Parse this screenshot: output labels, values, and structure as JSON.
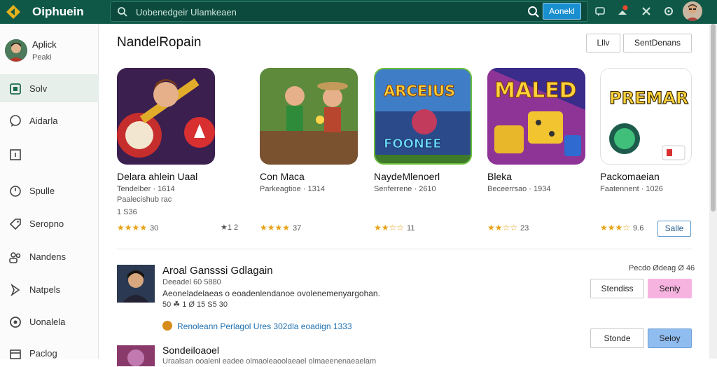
{
  "topbar": {
    "brand": "Oiphuein",
    "search_placeholder": "Uobenedgeir Ulamkeaen",
    "search_button": "Aonekl"
  },
  "sidebar": {
    "user_name": "Aplick",
    "user_sub": "Peaki",
    "items": [
      {
        "label": "Solv",
        "icon": "store-icon",
        "active": true
      },
      {
        "label": "Aidarla",
        "icon": "chat-icon"
      },
      {
        "label": "",
        "icon": "window-icon"
      },
      {
        "label": "Spulle",
        "icon": "clock-icon"
      },
      {
        "label": "Seropno",
        "icon": "tag-icon"
      },
      {
        "label": "Nandens",
        "icon": "people-icon"
      },
      {
        "label": "Natpels",
        "icon": "send-icon"
      },
      {
        "label": "Uonalela",
        "icon": "disc-icon"
      },
      {
        "label": "Paclog",
        "icon": "box-icon"
      }
    ]
  },
  "main": {
    "title": "NandelRopain",
    "header_buttons": [
      "Lllv",
      "SentDenans"
    ],
    "apps": [
      {
        "name": "Delara ahlein Uaal",
        "dev": "Tendelber · 1614",
        "meta": "Paalecishub rac",
        "meta2": "1 S36",
        "stars": "★★★★",
        "count": "30",
        "rating_extra": "★1 2"
      },
      {
        "name": "Con Maca",
        "dev": "Parkeagtioe · 1314",
        "meta": "",
        "meta2": "",
        "stars": "★★★★",
        "count": "37",
        "rating_extra": ""
      },
      {
        "name": "NaydeMlenoerl",
        "dev": "Senferrene · 2610",
        "meta": "",
        "meta2": "",
        "stars": "★★☆☆",
        "count": "11",
        "rating_extra": ""
      },
      {
        "name": "Bleka",
        "dev": "Beceerrsao · 1934",
        "meta": "",
        "meta2": "",
        "stars": "★★☆☆",
        "count": "23",
        "rating_extra": ""
      },
      {
        "name": "Packomaeian",
        "dev": "Faatennent · 1026",
        "meta": "",
        "meta2": "",
        "stars": "★★★☆",
        "count": "9.6",
        "rating_extra": ""
      }
    ],
    "small_button": "Salle",
    "featured": {
      "name": "Aroal Gansssi Gdlagain",
      "sub": "Deeadel 60 5880",
      "desc": "Aeoneladelaeas o eoadenlendanoe ovolenemenyargohan.",
      "meta": "50 ☘ 1 Ø 15 S5 30",
      "link": "Renoleann Perlagol Ures 302dla eoadign 1333",
      "right_label": "Pecdo Ødeag Ø 46",
      "btn1": "Stendiss",
      "btn2": "Seniy",
      "btn3": "Stonde",
      "btn4": "Seloy"
    },
    "second": {
      "name": "Sondeiloaoel",
      "desc": "Uraalsan ooalenl eadee olmaoleaoolaeael olmaeenenaeaelam"
    }
  }
}
